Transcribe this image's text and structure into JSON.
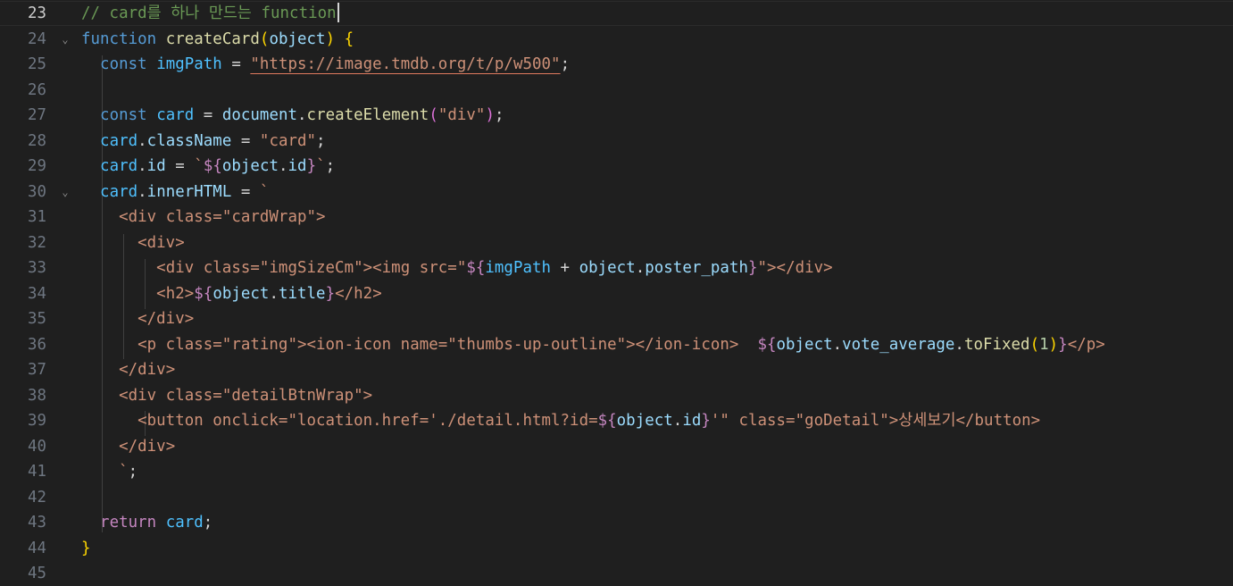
{
  "colors": {
    "background": "#1f1f1f",
    "line_number": "#6e7681",
    "line_number_active": "#cccccc",
    "comment": "#6a9955",
    "keyword": "#569cd6",
    "control": "#c586c0",
    "function": "#dcdcaa",
    "variable": "#9cdcfe",
    "constant": "#4fc1ff",
    "string": "#ce9178",
    "number": "#b5cea8",
    "tag": "#808080",
    "tag_name": "#569cd6",
    "attr": "#9cdcfe",
    "bracket1": "#ffd700",
    "bracket2": "#da70d6",
    "bracket3": "#179fff",
    "text": "#d4d4d4"
  },
  "editor": {
    "current_line": 23,
    "lines": [
      {
        "n": "23",
        "fold": "",
        "tokens": [
          [
            "// card를 하나 만드는 function",
            "comment"
          ]
        ],
        "cursor": true
      },
      {
        "n": "24",
        "fold": "⌄",
        "tokens": [
          [
            "function",
            "keyword"
          ],
          [
            " ",
            "text"
          ],
          [
            "createCard",
            "function"
          ],
          [
            "(",
            "bracket1"
          ],
          [
            "object",
            "variable"
          ],
          [
            ")",
            "bracket1"
          ],
          [
            " ",
            "text"
          ],
          [
            "{",
            "bracket1"
          ]
        ]
      },
      {
        "n": "25",
        "fold": "",
        "tokens": [
          [
            "  ",
            "text"
          ],
          [
            "const",
            "keyword"
          ],
          [
            " ",
            "text"
          ],
          [
            "imgPath",
            "constant"
          ],
          [
            " = ",
            "text"
          ],
          [
            "\"https://image.tmdb.org/t/p/w500\"",
            "string-ul"
          ],
          [
            ";",
            "text"
          ]
        ]
      },
      {
        "n": "26",
        "fold": "",
        "tokens": [
          [
            "",
            "text"
          ]
        ]
      },
      {
        "n": "27",
        "fold": "",
        "tokens": [
          [
            "  ",
            "text"
          ],
          [
            "const",
            "keyword"
          ],
          [
            " ",
            "text"
          ],
          [
            "card",
            "constant"
          ],
          [
            " = ",
            "text"
          ],
          [
            "document",
            "variable"
          ],
          [
            ".",
            "text"
          ],
          [
            "createElement",
            "function"
          ],
          [
            "(",
            "bracket2"
          ],
          [
            "\"div\"",
            "string"
          ],
          [
            ")",
            "bracket2"
          ],
          [
            ";",
            "text"
          ]
        ]
      },
      {
        "n": "28",
        "fold": "",
        "tokens": [
          [
            "  ",
            "text"
          ],
          [
            "card",
            "constant"
          ],
          [
            ".",
            "text"
          ],
          [
            "className",
            "variable"
          ],
          [
            " = ",
            "text"
          ],
          [
            "\"card\"",
            "string"
          ],
          [
            ";",
            "text"
          ]
        ]
      },
      {
        "n": "29",
        "fold": "",
        "tokens": [
          [
            "  ",
            "text"
          ],
          [
            "card",
            "constant"
          ],
          [
            ".",
            "text"
          ],
          [
            "id",
            "variable"
          ],
          [
            " = ",
            "text"
          ],
          [
            "`",
            "string"
          ],
          [
            "${",
            "control"
          ],
          [
            "object",
            "variable"
          ],
          [
            ".",
            "text"
          ],
          [
            "id",
            "variable"
          ],
          [
            "}",
            "control"
          ],
          [
            "`",
            "string"
          ],
          [
            ";",
            "text"
          ]
        ]
      },
      {
        "n": "30",
        "fold": "⌄",
        "tokens": [
          [
            "  ",
            "text"
          ],
          [
            "card",
            "constant"
          ],
          [
            ".",
            "text"
          ],
          [
            "innerHTML",
            "variable"
          ],
          [
            " = ",
            "text"
          ],
          [
            "`",
            "string"
          ]
        ]
      },
      {
        "n": "31",
        "fold": "",
        "tokens": [
          [
            "    ",
            "text"
          ],
          [
            "<div class=\"cardWrap\">",
            "string"
          ]
        ]
      },
      {
        "n": "32",
        "fold": "",
        "tokens": [
          [
            "      ",
            "text"
          ],
          [
            "<div>",
            "string"
          ]
        ]
      },
      {
        "n": "33",
        "fold": "",
        "tokens": [
          [
            "        ",
            "text"
          ],
          [
            "<div class=\"imgSizeCm\"><img src=\"",
            "string"
          ],
          [
            "${",
            "control"
          ],
          [
            "imgPath",
            "constant"
          ],
          [
            " + ",
            "text"
          ],
          [
            "object",
            "variable"
          ],
          [
            ".",
            "text"
          ],
          [
            "poster_path",
            "variable"
          ],
          [
            "}",
            "control"
          ],
          [
            "\"></div>",
            "string"
          ]
        ]
      },
      {
        "n": "34",
        "fold": "",
        "tokens": [
          [
            "        ",
            "text"
          ],
          [
            "<h2>",
            "string"
          ],
          [
            "${",
            "control"
          ],
          [
            "object",
            "variable"
          ],
          [
            ".",
            "text"
          ],
          [
            "title",
            "variable"
          ],
          [
            "}",
            "control"
          ],
          [
            "</h2>",
            "string"
          ]
        ]
      },
      {
        "n": "35",
        "fold": "",
        "tokens": [
          [
            "      ",
            "text"
          ],
          [
            "</div>",
            "string"
          ]
        ]
      },
      {
        "n": "36",
        "fold": "",
        "tokens": [
          [
            "      ",
            "text"
          ],
          [
            "<p class=\"rating\"><ion-icon name=\"thumbs-up-outline\"></ion-icon>  ",
            "string"
          ],
          [
            "${",
            "control"
          ],
          [
            "object",
            "variable"
          ],
          [
            ".",
            "text"
          ],
          [
            "vote_average",
            "variable"
          ],
          [
            ".",
            "text"
          ],
          [
            "toFixed",
            "function"
          ],
          [
            "(",
            "bracket1"
          ],
          [
            "1",
            "number"
          ],
          [
            ")",
            "bracket1"
          ],
          [
            "}",
            "control"
          ],
          [
            "</p>",
            "string"
          ]
        ]
      },
      {
        "n": "37",
        "fold": "",
        "tokens": [
          [
            "    ",
            "text"
          ],
          [
            "</div>",
            "string"
          ]
        ]
      },
      {
        "n": "38",
        "fold": "",
        "tokens": [
          [
            "    ",
            "text"
          ],
          [
            "<div class=\"detailBtnWrap\">",
            "string"
          ]
        ]
      },
      {
        "n": "39",
        "fold": "",
        "tokens": [
          [
            "      ",
            "text"
          ],
          [
            "<button onclick=\"location.href='./detail.html?id=",
            "string"
          ],
          [
            "${",
            "control"
          ],
          [
            "object",
            "variable"
          ],
          [
            ".",
            "text"
          ],
          [
            "id",
            "variable"
          ],
          [
            "}",
            "control"
          ],
          [
            "'\" class=\"goDetail\">상세보기</button>",
            "string"
          ]
        ]
      },
      {
        "n": "40",
        "fold": "",
        "tokens": [
          [
            "    ",
            "text"
          ],
          [
            "</div>",
            "string"
          ]
        ]
      },
      {
        "n": "41",
        "fold": "",
        "tokens": [
          [
            "    ",
            "text"
          ],
          [
            "`",
            "string"
          ],
          [
            ";",
            "text"
          ]
        ]
      },
      {
        "n": "42",
        "fold": "",
        "tokens": [
          [
            "",
            "text"
          ]
        ]
      },
      {
        "n": "43",
        "fold": "",
        "tokens": [
          [
            "  ",
            "text"
          ],
          [
            "return",
            "control"
          ],
          [
            " ",
            "text"
          ],
          [
            "card",
            "constant"
          ],
          [
            ";",
            "text"
          ]
        ]
      },
      {
        "n": "44",
        "fold": "",
        "tokens": [
          [
            "}",
            "bracket1"
          ]
        ]
      },
      {
        "n": "45",
        "fold": "",
        "tokens": [
          [
            "",
            "text"
          ]
        ]
      }
    ]
  }
}
